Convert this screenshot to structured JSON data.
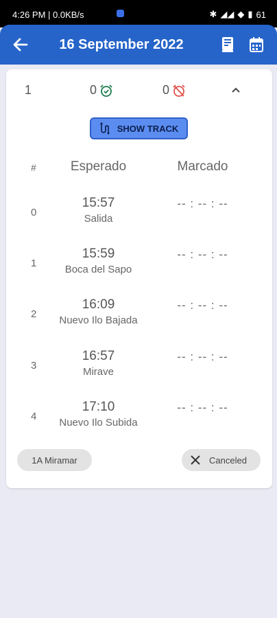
{
  "status_bar": {
    "time": "4:26 PM | 0.0KB/s",
    "battery": "61"
  },
  "app_bar": {
    "title": "16 September 2022",
    "back_icon": "arrow-left",
    "book_icon": "book",
    "calendar_icon": "calendar"
  },
  "trip": {
    "number": "1",
    "on_time_count": "0",
    "missed_count": "0",
    "show_track_label": "SHOW TRACK",
    "table": {
      "headers": {
        "index": "#",
        "expected": "Esperado",
        "marked": "Marcado"
      },
      "rows": [
        {
          "index": "0",
          "time": "15:57",
          "stop": "Salida",
          "marked": "-- : -- : --"
        },
        {
          "index": "1",
          "time": "15:59",
          "stop": "Boca del Sapo",
          "marked": "-- : -- : --"
        },
        {
          "index": "2",
          "time": "16:09",
          "stop": "Nuevo Ilo Bajada",
          "marked": "-- : -- : --"
        },
        {
          "index": "3",
          "time": "16:57",
          "stop": "Mirave",
          "marked": "-- : -- : --"
        },
        {
          "index": "4",
          "time": "17:10",
          "stop": "Nuevo Ilo Subida",
          "marked": "-- : -- : --"
        }
      ]
    },
    "route_chip": "1A Miramar",
    "status_chip": "Canceled"
  },
  "colors": {
    "app_bar": "#2664c9",
    "on_time": "#1e7a4d",
    "missed": "#e0524f",
    "show_track_bg": "#5b8cf0"
  }
}
